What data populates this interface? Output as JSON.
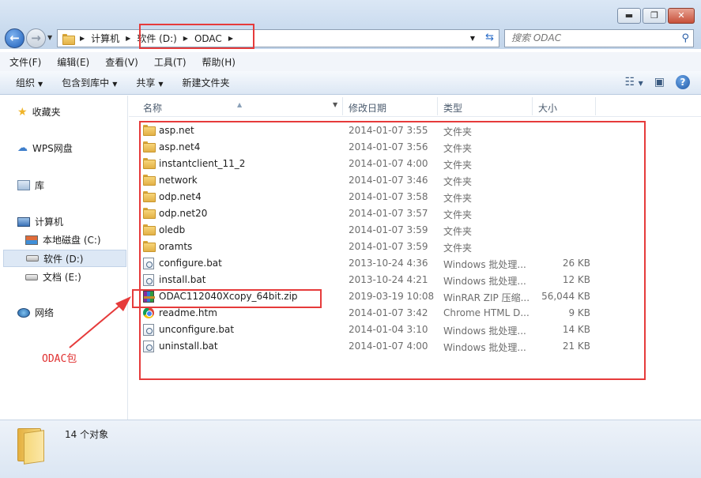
{
  "window": {
    "controls": {
      "minimize": "▬",
      "maximize": "❐",
      "close": "✕"
    }
  },
  "address": {
    "crumbs": [
      "计算机",
      "软件 (D:)",
      "ODAC"
    ],
    "search_placeholder": "搜索 ODAC"
  },
  "menu": [
    "文件(F)",
    "编辑(E)",
    "查看(V)",
    "工具(T)",
    "帮助(H)"
  ],
  "commands": {
    "organize": "组织",
    "include_library": "包含到库中",
    "share": "共享",
    "new_folder": "新建文件夹"
  },
  "nav": {
    "favorites": "收藏夹",
    "wps": "WPS网盘",
    "library": "库",
    "computer": "计算机",
    "drive_c": "本地磁盘 (C:)",
    "drive_d": "软件 (D:)",
    "drive_e": "文档 (E:)",
    "network": "网络"
  },
  "columns": {
    "name": "名称",
    "date": "修改日期",
    "type": "类型",
    "size": "大小"
  },
  "files": [
    {
      "name": "asp.net",
      "date": "2014-01-07 3:55",
      "type": "文件夹",
      "size": "",
      "icon": "folder-icon"
    },
    {
      "name": "asp.net4",
      "date": "2014-01-07 3:56",
      "type": "文件夹",
      "size": "",
      "icon": "folder-icon"
    },
    {
      "name": "instantclient_11_2",
      "date": "2014-01-07 4:00",
      "type": "文件夹",
      "size": "",
      "icon": "folder-icon"
    },
    {
      "name": "network",
      "date": "2014-01-07 3:46",
      "type": "文件夹",
      "size": "",
      "icon": "folder-icon"
    },
    {
      "name": "odp.net4",
      "date": "2014-01-07 3:58",
      "type": "文件夹",
      "size": "",
      "icon": "folder-icon"
    },
    {
      "name": "odp.net20",
      "date": "2014-01-07 3:57",
      "type": "文件夹",
      "size": "",
      "icon": "folder-icon"
    },
    {
      "name": "oledb",
      "date": "2014-01-07 3:59",
      "type": "文件夹",
      "size": "",
      "icon": "folder-icon"
    },
    {
      "name": "oramts",
      "date": "2014-01-07 3:59",
      "type": "文件夹",
      "size": "",
      "icon": "folder-icon"
    },
    {
      "name": "configure.bat",
      "date": "2013-10-24 4:36",
      "type": "Windows 批处理...",
      "size": "26 KB",
      "icon": "batch-file-icon"
    },
    {
      "name": "install.bat",
      "date": "2013-10-24 4:21",
      "type": "Windows 批处理...",
      "size": "12 KB",
      "icon": "batch-file-icon"
    },
    {
      "name": "ODAC112040Xcopy_64bit.zip",
      "date": "2019-03-19 10:08",
      "type": "WinRAR ZIP 压缩...",
      "size": "56,044 KB",
      "icon": "zip-file-icon"
    },
    {
      "name": "readme.htm",
      "date": "2014-01-07 3:42",
      "type": "Chrome HTML D...",
      "size": "9 KB",
      "icon": "chrome-html-icon"
    },
    {
      "name": "unconfigure.bat",
      "date": "2014-01-04 3:10",
      "type": "Windows 批处理...",
      "size": "14 KB",
      "icon": "batch-file-icon"
    },
    {
      "name": "uninstall.bat",
      "date": "2014-01-07 4:00",
      "type": "Windows 批处理...",
      "size": "21 KB",
      "icon": "batch-file-icon"
    }
  ],
  "status": {
    "count": "14 个对象"
  },
  "annotation": {
    "label": "ODAC包",
    "color": "#e63b3b"
  }
}
